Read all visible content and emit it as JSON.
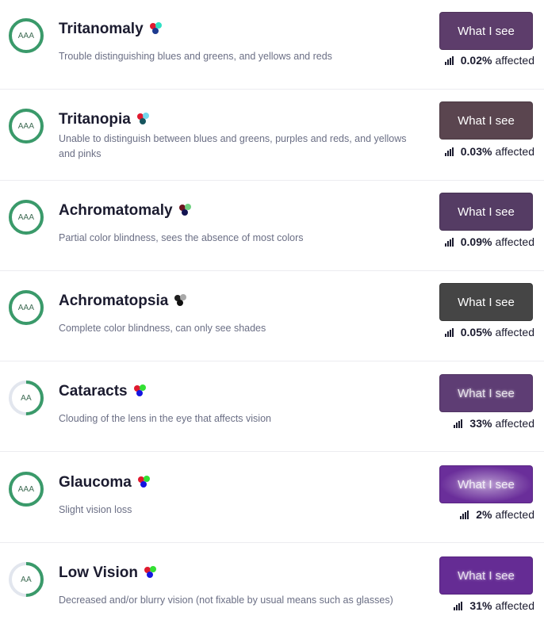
{
  "items": [
    {
      "level": "AAA",
      "level_fraction": 1.0,
      "name": "Tritanomaly",
      "description": "Trouble distinguishing blues and greens, and yellows and reds",
      "button_label": "What I see",
      "button_color": "#5d3d6b",
      "percent": "0.02%",
      "affected_label": "affected",
      "dots": [
        "#e0192e",
        "#2fe0c4",
        "#1d3a8f"
      ]
    },
    {
      "level": "AAA",
      "level_fraction": 1.0,
      "name": "Tritanopia",
      "description": "Unable to distinguish between blues and greens, purples and reds, and yellows and pinks",
      "button_label": "What I see",
      "button_color": "#5a454f",
      "percent": "0.03%",
      "affected_label": "affected",
      "dots": [
        "#e0192e",
        "#74d8ec",
        "#16555e"
      ]
    },
    {
      "level": "AAA",
      "level_fraction": 1.0,
      "name": "Achromatomaly",
      "description": "Partial color blindness, sees the absence of most colors",
      "button_label": "What I see",
      "button_color": "#553c64",
      "percent": "0.09%",
      "affected_label": "affected",
      "dots": [
        "#6b1420",
        "#6fd080",
        "#141452"
      ]
    },
    {
      "level": "AAA",
      "level_fraction": 1.0,
      "name": "Achromatopsia",
      "description": "Complete color blindness, can only see shades",
      "button_label": "What I see",
      "button_color": "#454545",
      "percent": "0.05%",
      "affected_label": "affected",
      "dots": [
        "#1e1e1e",
        "#a8a8a8",
        "#101010"
      ]
    },
    {
      "level": "AA",
      "level_fraction": 0.5,
      "name": "Cataracts",
      "description": "Clouding of the lens in the eye that affects vision",
      "button_label": "What I see",
      "button_color": "#5e3d74",
      "percent": "33%",
      "affected_label": "affected",
      "dots": [
        "#e0192e",
        "#33e033",
        "#1515e0"
      ]
    },
    {
      "level": "AAA",
      "level_fraction": 1.0,
      "name": "Glaucoma",
      "description": "Slight vision loss",
      "button_label": "What I see",
      "button_color": "#6a2e9a",
      "percent": "2%",
      "affected_label": "affected",
      "dots": [
        "#e0192e",
        "#33e033",
        "#1515e0"
      ]
    },
    {
      "level": "AA",
      "level_fraction": 0.5,
      "name": "Low Vision",
      "description": "Decreased and/or blurry vision (not fixable by usual means such as glasses)",
      "button_label": "What I see",
      "button_color": "#652c94",
      "percent": "31%",
      "affected_label": "affected",
      "dots": [
        "#e0192e",
        "#33e033",
        "#1515e0"
      ]
    }
  ],
  "colors": {
    "ring_pass": "#3a9a6a",
    "ring_track": "#e2e6ee"
  }
}
